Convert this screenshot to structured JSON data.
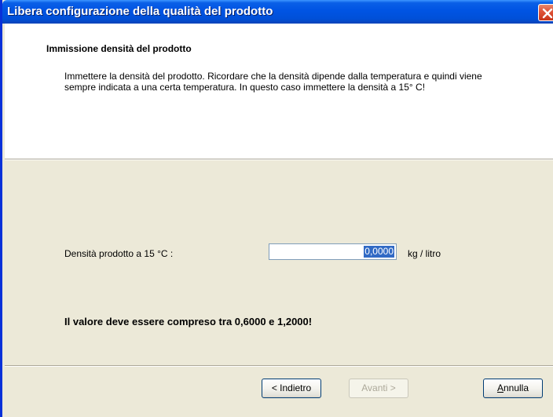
{
  "window": {
    "title": "Libera configurazione della qualità del prodotto"
  },
  "header": {
    "title": "Immissione densità del prodotto",
    "description": "Immettere la densità del prodotto. Ricordare che la densità dipende dalla temperatura e quindi viene sempre indicata a una certa temperatura. In questo caso immettere la densità a 15° C!"
  },
  "form": {
    "density_label": "Densità prodotto a 15 °C :",
    "density_value": "0,0000",
    "unit": "kg / litro",
    "range_message": "Il valore deve essere compreso tra 0,6000 e 1,2000!"
  },
  "buttons": {
    "back": "< Indietro",
    "next": "Avanti >",
    "cancel_underlined": "A",
    "cancel_rest": "nnulla"
  },
  "colors": {
    "titlebar": "#0054e3",
    "close_button": "#e0553a",
    "selection": "#316ac5",
    "dialog_bg": "#ece9d8"
  }
}
